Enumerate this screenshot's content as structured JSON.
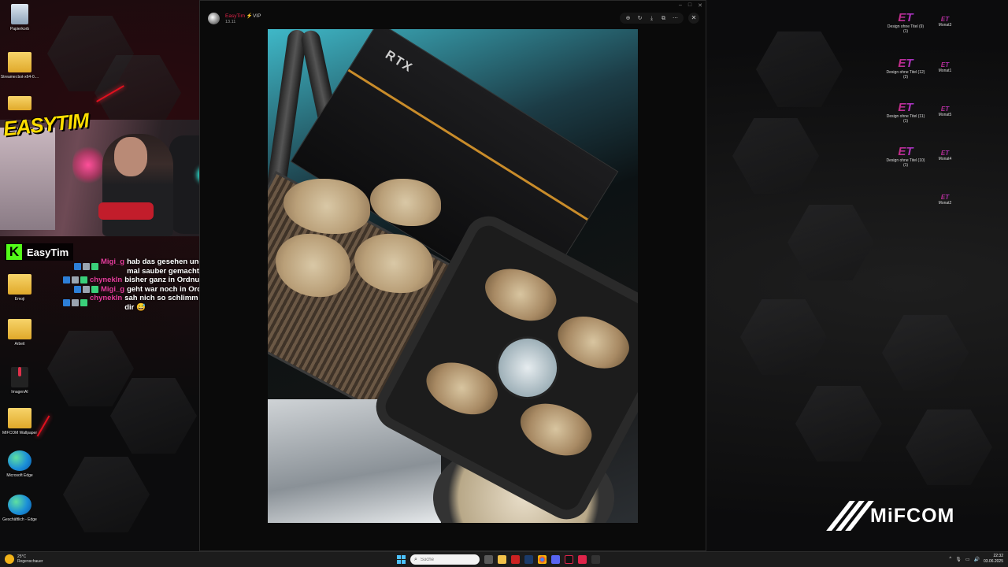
{
  "desktop": {
    "left_icons": [
      {
        "label": "Papierkorb",
        "icon": "recycle-bin-icon"
      },
      {
        "label": "Streamer.bot-x64-0....",
        "icon": "folder-icon"
      },
      {
        "label": "Emoji",
        "icon": "folder-icon"
      },
      {
        "label": "Arbeit",
        "icon": "folder-icon"
      },
      {
        "label": "ImagenAI",
        "icon": "imagenai-icon"
      },
      {
        "label": "MIFCOM Wallpaper",
        "icon": "folder-icon"
      },
      {
        "label": "Microsoft Edge",
        "icon": "edge-icon"
      },
      {
        "label": "Geschäftlich - Edge",
        "icon": "edge-icon"
      }
    ],
    "right_icons": [
      {
        "label": "Design ohne Titel (9) (1)",
        "glyph": "ET"
      },
      {
        "label": "Monat3",
        "glyph": "ET"
      },
      {
        "label": "Design ohne Titel (12) (2)",
        "glyph": "ET"
      },
      {
        "label": "Monat1",
        "glyph": "ET"
      },
      {
        "label": "Design ohne Titel (11) (1)",
        "glyph": "ET"
      },
      {
        "label": "Monat5",
        "glyph": "ET"
      },
      {
        "label": "Design ohne Titel (10) (1)",
        "glyph": "ET"
      },
      {
        "label": "Monat4",
        "glyph": "ET"
      },
      {
        "label": "Monat2",
        "glyph": "ET"
      }
    ]
  },
  "overlay": {
    "logo_text": "EASYTIM",
    "kick_letter": "K",
    "channel_name": "EasyTim"
  },
  "chat": [
    {
      "user": "Migi_g",
      "message": "hab das gesehen und meinen mal sauber gemacht"
    },
    {
      "user": "chynekln",
      "message": "bisher ganz in Ordnung"
    },
    {
      "user": "Migi_g",
      "message": "geht war noch in Ordnung"
    },
    {
      "user": "chynekln",
      "message": "sah nich so schlimm aus wie bei dir 😅"
    }
  ],
  "viewer": {
    "author": "EasyTim",
    "badge": "⚡VIP",
    "date": "13.11",
    "toolbar": [
      "zoom-icon",
      "rotate-icon",
      "download-icon",
      "external-icon",
      "more-icon"
    ],
    "photo_label": "RTX"
  },
  "brand": {
    "name": "MiFCOM"
  },
  "taskbar": {
    "weather_temp": "25°C",
    "weather_text": "Regenschauer",
    "search_placeholder": "Suche",
    "time": "22:32",
    "date": "03.06.2025"
  },
  "colors": {
    "accent_red": "#e0101e",
    "kick_green": "#53fc18",
    "chat_user": "#e23b9a",
    "logo_yellow": "#ffdd00"
  }
}
